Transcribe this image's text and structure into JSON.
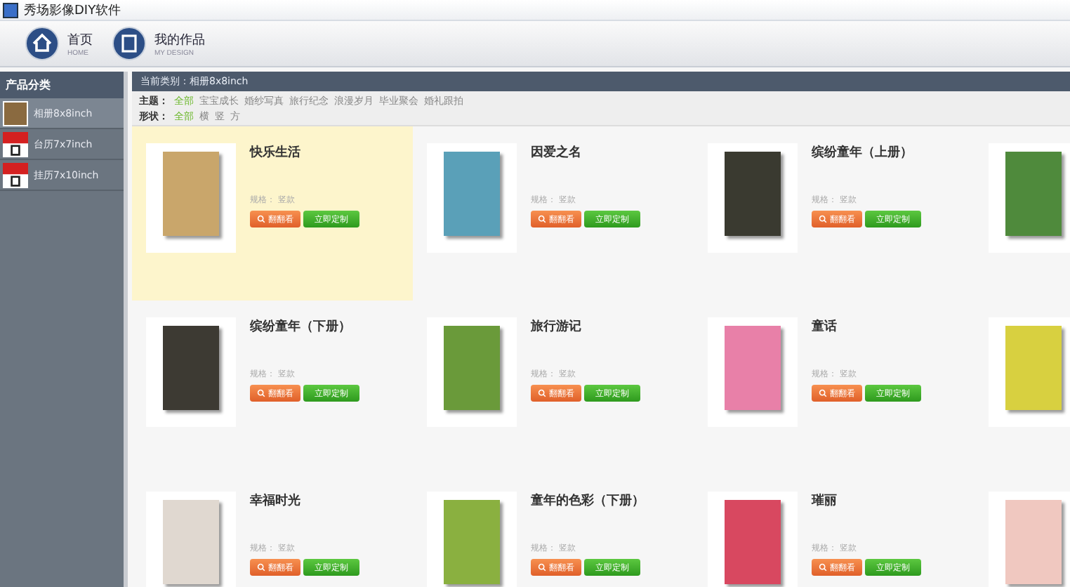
{
  "window": {
    "title": "秀场影像DIY软件"
  },
  "toolbar": [
    {
      "label": "首页",
      "sublabel": "HOME",
      "kind": "home"
    },
    {
      "label": "我的作品",
      "sublabel": "MY DESIGN",
      "kind": "design"
    }
  ],
  "sidebar": {
    "title": "产品分类",
    "items": [
      {
        "label": "相册8x8inch",
        "kind": "album",
        "selected": true
      },
      {
        "label": "台历7x7inch",
        "kind": "calendar",
        "selected": false
      },
      {
        "label": "挂历7x10inch",
        "kind": "calendar",
        "selected": false
      }
    ]
  },
  "category_bar": {
    "label": "当前类别：",
    "value": "相册8x8inch"
  },
  "filters": [
    {
      "label": "主题：",
      "options": [
        {
          "label": "全部",
          "selected": true
        },
        {
          "label": "宝宝成长",
          "selected": false
        },
        {
          "label": "婚纱写真",
          "selected": false
        },
        {
          "label": "旅行纪念",
          "selected": false
        },
        {
          "label": "浪漫岁月",
          "selected": false
        },
        {
          "label": "毕业聚会",
          "selected": false
        },
        {
          "label": "婚礼跟拍",
          "selected": false
        }
      ]
    },
    {
      "label": "形状：",
      "options": [
        {
          "label": "全部",
          "selected": true
        },
        {
          "label": "横",
          "selected": false
        },
        {
          "label": "竖",
          "selected": false
        },
        {
          "label": "方",
          "selected": false
        }
      ]
    }
  ],
  "products": [
    {
      "title": "快乐生活",
      "spec": "规格： 竖款",
      "preview": "翻翻看",
      "customize": "立即定制",
      "selected": true
    },
    {
      "title": "因爱之名",
      "spec": "规格： 竖款",
      "preview": "翻翻看",
      "customize": "立即定制",
      "selected": false
    },
    {
      "title": "缤纷童年（上册）",
      "spec": "规格： 竖款",
      "preview": "翻翻看",
      "customize": "立即定制",
      "selected": false
    },
    {
      "selected": false
    },
    {
      "title": "缤纷童年（下册）",
      "spec": "规格： 竖款",
      "preview": "翻翻看",
      "customize": "立即定制",
      "selected": false
    },
    {
      "title": "旅行游记",
      "spec": "规格： 竖款",
      "preview": "翻翻看",
      "customize": "立即定制",
      "selected": false
    },
    {
      "title": "童话",
      "spec": "规格： 竖款",
      "preview": "翻翻看",
      "customize": "立即定制",
      "selected": false
    },
    {
      "selected": false
    },
    {
      "title": "幸福时光",
      "spec": "规格： 竖款",
      "preview": "翻翻看",
      "customize": "立即定制",
      "selected": false
    },
    {
      "title": "童年的色彩（下册）",
      "spec": "规格： 竖款",
      "preview": "翻翻看",
      "customize": "立即定制",
      "selected": false
    },
    {
      "title": "璀丽",
      "spec": "规格： 竖款",
      "preview": "翻翻看",
      "customize": "立即定制",
      "selected": false
    },
    {
      "selected": false
    }
  ]
}
